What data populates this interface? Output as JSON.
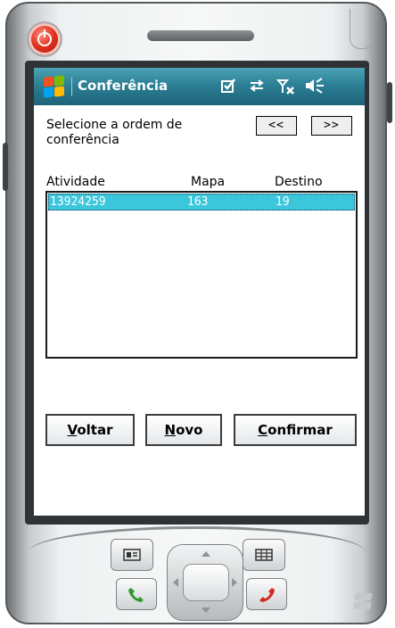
{
  "app": {
    "title": "Conferência"
  },
  "status_icons": [
    "checkbox-icon",
    "sync-arrows-icon",
    "signal-off-icon",
    "speaker-icon"
  ],
  "form": {
    "prompt": "Selecione a ordem de conferência",
    "prev_label": "<<",
    "next_label": ">>"
  },
  "list": {
    "columns": [
      "Atividade",
      "Mapa",
      "Destino"
    ],
    "rows": [
      {
        "atividade": "13924259",
        "mapa": "163",
        "destino": "19",
        "selected": true
      }
    ]
  },
  "buttons": {
    "voltar": {
      "mnemonic": "V",
      "rest": "oltar"
    },
    "novo": {
      "mnemonic": "N",
      "rest": "ovo"
    },
    "confirmar": {
      "mnemonic": "C",
      "rest": "onfirmar"
    }
  },
  "colors": {
    "titlebar": "#2c7f95",
    "selection": "#3cc6dc"
  }
}
